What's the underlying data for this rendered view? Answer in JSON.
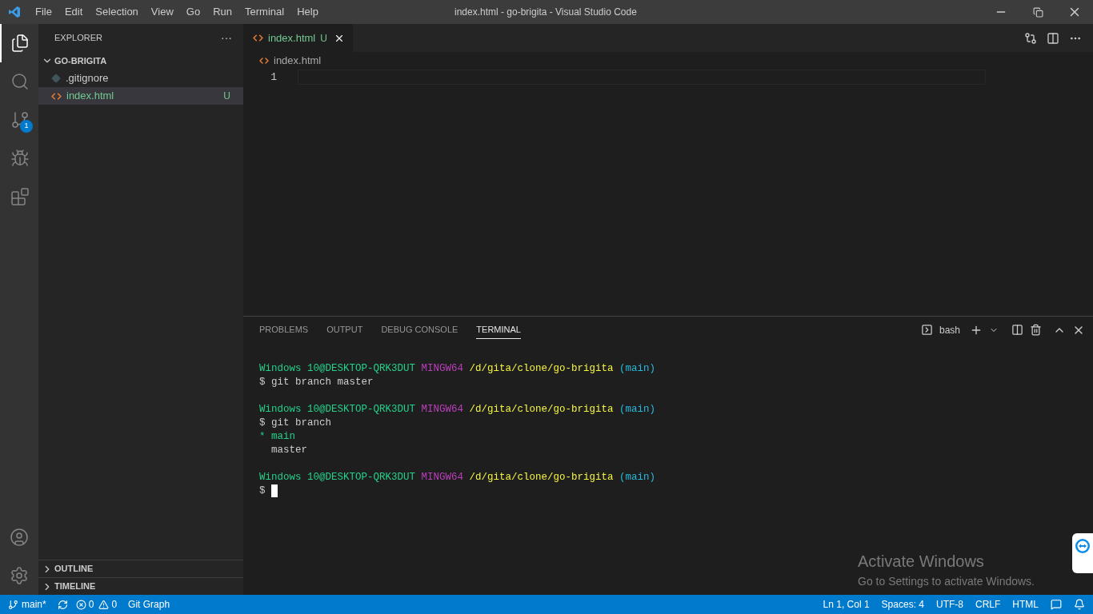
{
  "window": {
    "title": "index.html - go-brigita - Visual Studio Code"
  },
  "menu": [
    "File",
    "Edit",
    "Selection",
    "View",
    "Go",
    "Run",
    "Terminal",
    "Help"
  ],
  "activity_bar": [
    {
      "kind": "explorer",
      "selected": true
    },
    {
      "kind": "search",
      "selected": false
    },
    {
      "kind": "source-control",
      "selected": false,
      "badge": "1"
    },
    {
      "kind": "run",
      "selected": false
    },
    {
      "kind": "extensions",
      "selected": false
    }
  ],
  "sidebar": {
    "title": "EXPLORER",
    "more": "···",
    "folder": {
      "name": "GO-BRIGITA",
      "expanded": true,
      "children": [
        {
          "name": ".gitignore",
          "kind": "git",
          "selected": false
        },
        {
          "name": "index.html",
          "kind": "html",
          "selected": true,
          "status": "U"
        }
      ]
    },
    "sections": [
      {
        "name": "OUTLINE",
        "expanded": false
      },
      {
        "name": "TIMELINE",
        "expanded": false
      }
    ]
  },
  "editor": {
    "tabs": [
      {
        "label": "index.html",
        "status": "U",
        "selected": true
      }
    ],
    "breadcrumb": "index.html",
    "line_numbers": [
      "1"
    ]
  },
  "panel": {
    "tabs": [
      {
        "label": "PROBLEMS",
        "selected": false
      },
      {
        "label": "OUTPUT",
        "selected": false
      },
      {
        "label": "DEBUG CONSOLE",
        "selected": false
      },
      {
        "label": "TERMINAL",
        "selected": true
      }
    ],
    "shell": "bash",
    "terminal_blocks": [
      [
        [
          {
            "kind": "user",
            "text": "Windows 10@DESKTOP-QRK3DUT"
          },
          {
            "kind": "system",
            "text": " MINGW64"
          },
          {
            "kind": "path",
            "text": " /d/gita/clone/go-brigita"
          },
          {
            "kind": "branch",
            "text": " (main)"
          }
        ],
        [
          {
            "kind": "plain",
            "text": "$ git branch master"
          }
        ]
      ],
      [
        [
          {
            "kind": "user",
            "text": "Windows 10@DESKTOP-QRK3DUT"
          },
          {
            "kind": "system",
            "text": " MINGW64"
          },
          {
            "kind": "path",
            "text": " /d/gita/clone/go-brigita"
          },
          {
            "kind": "branch",
            "text": " (main)"
          }
        ],
        [
          {
            "kind": "plain",
            "text": "$ git branch"
          }
        ],
        [
          {
            "kind": "current",
            "text": "* main"
          }
        ],
        [
          {
            "kind": "plain",
            "text": "  master"
          }
        ]
      ],
      [
        [
          {
            "kind": "user",
            "text": "Windows 10@DESKTOP-QRK3DUT"
          },
          {
            "kind": "system",
            "text": " MINGW64"
          },
          {
            "kind": "path",
            "text": " /d/gita/clone/go-brigita"
          },
          {
            "kind": "branch",
            "text": " (main)"
          }
        ],
        [
          {
            "kind": "plain",
            "text": "$ "
          },
          {
            "kind": "cursor"
          }
        ]
      ]
    ]
  },
  "os_notice": {
    "title": "Activate Windows",
    "text": "Go to Settings to activate Windows."
  },
  "status_bar": {
    "branch": "main*",
    "errors": "0",
    "warnings": "0",
    "git_graph": "Git Graph",
    "position": "Ln 1, Col 1",
    "spaces": "Spaces: 4",
    "encoding": "UTF-8",
    "eol": "CRLF",
    "language": "HTML"
  }
}
